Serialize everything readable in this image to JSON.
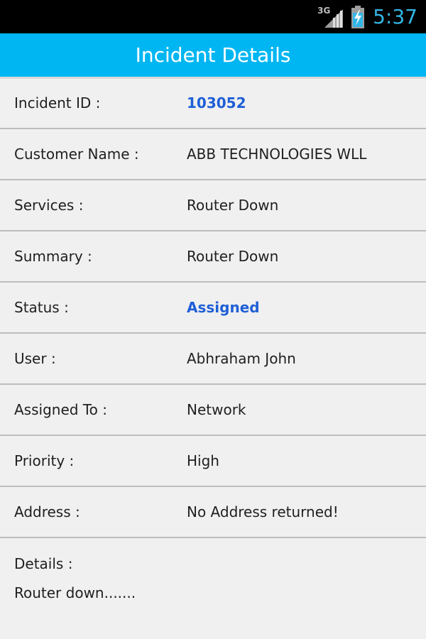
{
  "status_bar": {
    "network_type": "3G",
    "time": "5:37",
    "icons": [
      "signal-icon",
      "battery-charging-icon"
    ]
  },
  "header": {
    "title": "Incident Details"
  },
  "incident": {
    "rows": [
      {
        "label": "Incident ID :",
        "value": "103052"
      },
      {
        "label": "Customer Name :",
        "value": "ABB TECHNOLOGIES WLL"
      },
      {
        "label": "Services :",
        "value": "Router Down"
      },
      {
        "label": "Summary :",
        "value": "Router Down"
      },
      {
        "label": "Status :",
        "value": "Assigned"
      },
      {
        "label": "User :",
        "value": "Abhraham John"
      },
      {
        "label": "Assigned To :",
        "value": "Network"
      },
      {
        "label": "Priority :",
        "value": "High"
      },
      {
        "label": "Address :",
        "value": "No Address returned!"
      }
    ],
    "details_label": "Details :",
    "details_text": "Router down......."
  },
  "colors": {
    "status_bar_bg": "#000000",
    "clock": "#33b5e5",
    "title_bar_bg": "#00b6f2",
    "accent_value": "#1f5fd6",
    "page_bg": "#f0f0f0",
    "divider": "#bdbdbd"
  }
}
